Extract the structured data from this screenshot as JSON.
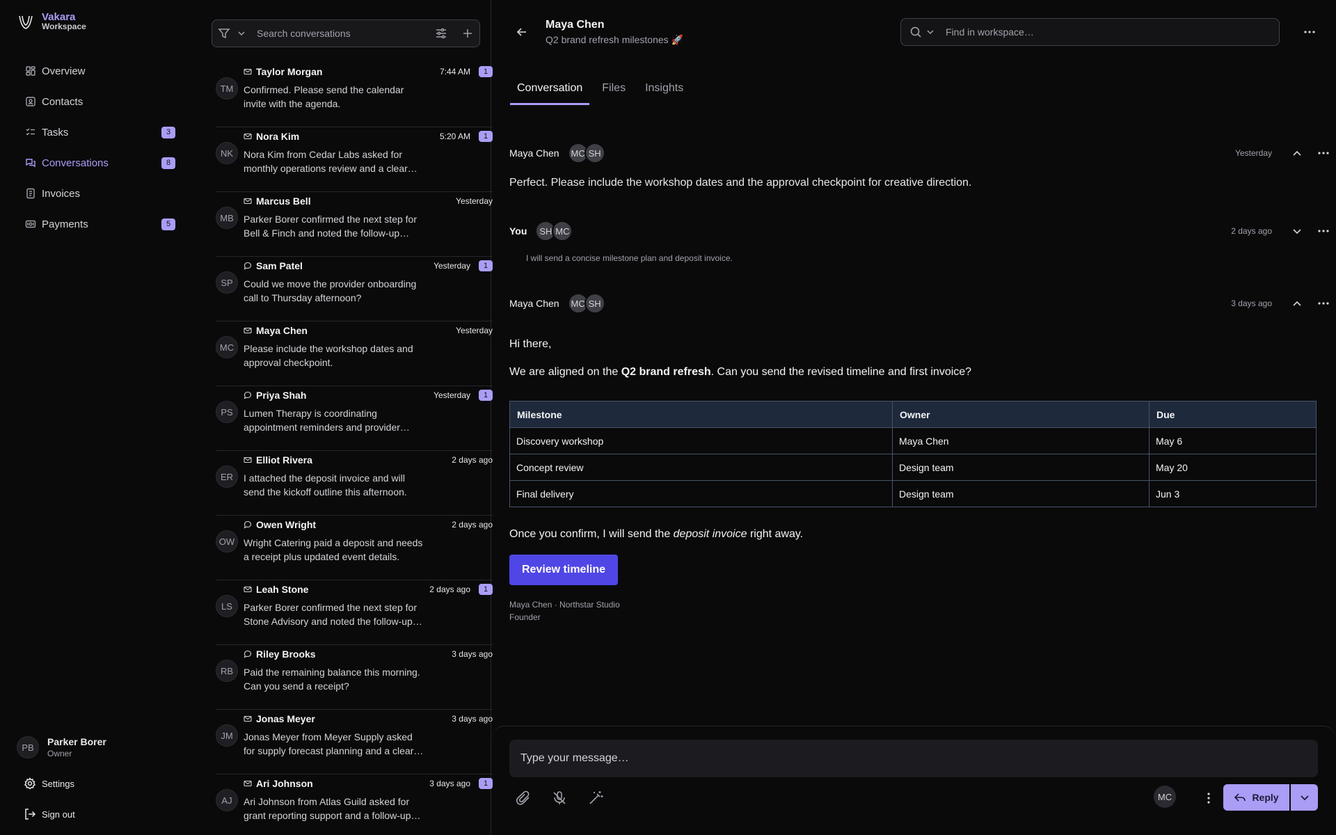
{
  "brand": {
    "name": "Vakara",
    "sub": "Workspace"
  },
  "nav": [
    {
      "label": "Overview",
      "icon": "dashboard-icon",
      "badge": ""
    },
    {
      "label": "Contacts",
      "icon": "contacts-icon",
      "badge": ""
    },
    {
      "label": "Tasks",
      "icon": "tasks-icon",
      "badge": "3"
    },
    {
      "label": "Conversations",
      "icon": "conversations-icon",
      "badge": "8",
      "active": true
    },
    {
      "label": "Invoices",
      "icon": "invoice-icon",
      "badge": ""
    },
    {
      "label": "Payments",
      "icon": "payments-icon",
      "badge": "5"
    }
  ],
  "user": {
    "initials": "PB",
    "name": "Parker Borer",
    "role": "Owner"
  },
  "settings_label": "Settings",
  "signout_label": "Sign out",
  "list": {
    "search_placeholder": "Search conversations",
    "threads": [
      {
        "initials": "TM",
        "kind": "email",
        "name": "Taylor Morgan",
        "time": "7:44 AM",
        "unread": "1",
        "preview": "Confirmed. Please send the calendar invite with the agenda."
      },
      {
        "initials": "NK",
        "kind": "email",
        "name": "Nora Kim",
        "time": "5:20 AM",
        "unread": "1",
        "preview": "Nora Kim from Cedar Labs asked for monthly operations review and a clear next step for the team."
      },
      {
        "initials": "MB",
        "kind": "email",
        "name": "Marcus Bell",
        "time": "Yesterday",
        "unread": "",
        "preview": "Parker Borer confirmed the next step for Bell & Finch and noted the follow-up items."
      },
      {
        "initials": "SP",
        "kind": "chat",
        "name": "Sam Patel",
        "time": "Yesterday",
        "unread": "1",
        "preview": "Could we move the provider onboarding call to Thursday afternoon?"
      },
      {
        "initials": "MC",
        "kind": "email",
        "name": "Maya Chen",
        "time": "Yesterday",
        "unread": "",
        "preview": "Please include the workshop dates and approval checkpoint."
      },
      {
        "initials": "PS",
        "kind": "chat",
        "name": "Priya Shah",
        "time": "Yesterday",
        "unread": "1",
        "preview": "Lumen Therapy is coordinating appointment reminders and provider schedules."
      },
      {
        "initials": "ER",
        "kind": "email",
        "name": "Elliot Rivera",
        "time": "2 days ago",
        "unread": "",
        "preview": "I attached the deposit invoice and will send the kickoff outline this afternoon."
      },
      {
        "initials": "OW",
        "kind": "chat",
        "name": "Owen Wright",
        "time": "2 days ago",
        "unread": "",
        "preview": "Wright Catering paid a deposit and needs a receipt plus updated event details."
      },
      {
        "initials": "LS",
        "kind": "email",
        "name": "Leah Stone",
        "time": "2 days ago",
        "unread": "1",
        "preview": "Parker Borer confirmed the next step for Stone Advisory and noted the follow-up items."
      },
      {
        "initials": "RB",
        "kind": "chat",
        "name": "Riley Brooks",
        "time": "3 days ago",
        "unread": "",
        "preview": "Paid the remaining balance this morning. Can you send a receipt?"
      },
      {
        "initials": "JM",
        "kind": "email",
        "name": "Jonas Meyer",
        "time": "3 days ago",
        "unread": "",
        "preview": "Jonas Meyer from Meyer Supply asked for supply forecast planning and a clear next step."
      },
      {
        "initials": "AJ",
        "kind": "email",
        "name": "Ari Johnson",
        "time": "3 days ago",
        "unread": "1",
        "preview": "Ari Johnson from Atlas Guild asked for grant reporting support and a follow-up call."
      }
    ]
  },
  "main": {
    "title": "Maya Chen",
    "subtitle": "Q2 brand refresh milestones 🚀",
    "search_placeholder": "Find in workspace…",
    "tabs": [
      "Conversation",
      "Files",
      "Insights"
    ],
    "messages": {
      "m1": {
        "from": "Maya Chen",
        "chips": [
          "MC",
          "SH"
        ],
        "time": "Yesterday",
        "text": "Perfect. Please include the workshop dates and the approval checkpoint for creative direction."
      },
      "m2": {
        "from": "You",
        "chips": [
          "SH",
          "MC"
        ],
        "time": "2 days ago",
        "text": "I will send a concise milestone plan and deposit invoice."
      },
      "m3": {
        "from": "Maya Chen",
        "chips": [
          "MC",
          "SH"
        ],
        "time": "3 days ago",
        "greeting": "Hi there,",
        "line1_pre": "We are aligned on the ",
        "line1_bold": "Q2 brand refresh",
        "line1_post": ". Can you send the revised timeline and first invoice?",
        "table_headers": [
          "Milestone",
          "Owner",
          "Due"
        ],
        "table_rows": [
          [
            "Discovery workshop",
            "Maya Chen",
            "May 6"
          ],
          [
            "Concept review",
            "Design team",
            "May 20"
          ],
          [
            "Final delivery",
            "Design team",
            "Jun 3"
          ]
        ],
        "line2_pre": "Once you confirm, I will send the ",
        "line2_em": "deposit invoice",
        "line2_post": " right away.",
        "cta": "Review timeline",
        "sig_line1": "Maya Chen · Northstar Studio",
        "sig_line2": "Founder"
      }
    },
    "composer": {
      "placeholder": "Type your message…",
      "avatar": "MC",
      "reply_label": "Reply"
    }
  },
  "colors": {
    "accent": "#a99df6",
    "cta": "#4f46e5",
    "background": "#0a0a0b",
    "table_header": "#1e293b"
  }
}
